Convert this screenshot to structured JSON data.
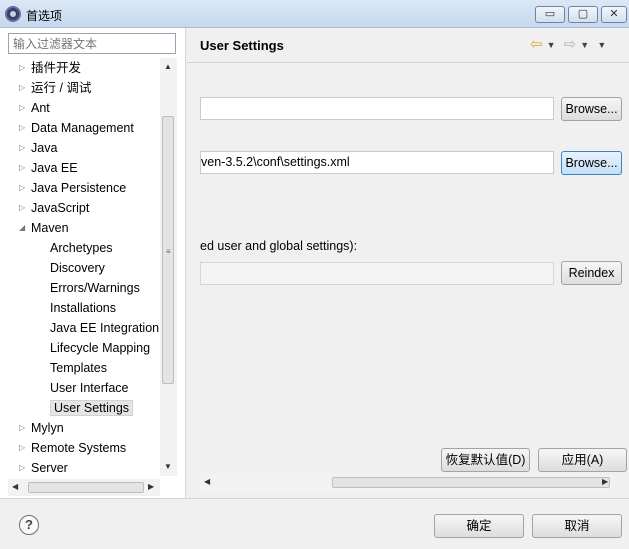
{
  "window": {
    "title": "首选项",
    "minimize_label": "▭",
    "maximize_label": "▢",
    "close_label": "✕"
  },
  "filter": {
    "placeholder": "输入过滤器文本"
  },
  "tree": {
    "items": [
      {
        "label": "插件开发",
        "expanded": false,
        "level": 0
      },
      {
        "label": "运行 / 调试",
        "expanded": false,
        "level": 0
      },
      {
        "label": "Ant",
        "expanded": false,
        "level": 0
      },
      {
        "label": "Data Management",
        "expanded": false,
        "level": 0
      },
      {
        "label": "Java",
        "expanded": false,
        "level": 0
      },
      {
        "label": "Java EE",
        "expanded": false,
        "level": 0
      },
      {
        "label": "Java Persistence",
        "expanded": false,
        "level": 0
      },
      {
        "label": "JavaScript",
        "expanded": false,
        "level": 0
      },
      {
        "label": "Maven",
        "expanded": true,
        "level": 0
      },
      {
        "label": "Archetypes",
        "level": 1
      },
      {
        "label": "Discovery",
        "level": 1
      },
      {
        "label": "Errors/Warnings",
        "level": 1
      },
      {
        "label": "Installations",
        "level": 1
      },
      {
        "label": "Java EE Integration",
        "level": 1
      },
      {
        "label": "Lifecycle Mapping",
        "level": 1
      },
      {
        "label": "Templates",
        "level": 1
      },
      {
        "label": "User Interface",
        "level": 1
      },
      {
        "label": "User Settings",
        "level": 1,
        "selected": true
      },
      {
        "label": "Mylyn",
        "expanded": false,
        "level": 0
      },
      {
        "label": "Remote Systems",
        "expanded": false,
        "level": 0
      },
      {
        "label": "Server",
        "expanded": false,
        "level": 0
      }
    ]
  },
  "page": {
    "title": "User Settings",
    "global_settings_value": "",
    "global_browse_label": "Browse...",
    "user_settings_value": "ven-3.5.2\\conf\\settings.xml",
    "user_browse_label": "Browse...",
    "local_repo_caption": "ed user and global settings):",
    "local_repo_value": "",
    "reindex_label": "Reindex",
    "restore_defaults_label": "恢复默认值(D)",
    "apply_label": "应用(A)"
  },
  "dialog": {
    "ok_label": "确定",
    "cancel_label": "取消",
    "help_label": "?"
  },
  "colors": {
    "nav_arrow": "#d9a43a",
    "focus_border": "#3b82c4"
  }
}
